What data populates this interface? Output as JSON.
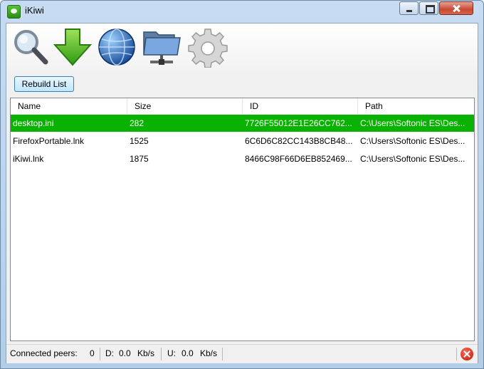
{
  "window": {
    "title": "iKiwi"
  },
  "toolbar": {
    "icons": [
      "search-icon",
      "download-icon",
      "globe-icon",
      "shared-folder-icon",
      "gear-icon"
    ]
  },
  "actions": {
    "rebuild_label": "Rebuild List"
  },
  "files": {
    "columns": [
      "Name",
      "Size",
      "ID",
      "Path"
    ],
    "rows": [
      {
        "name": "desktop.ini",
        "size": "282",
        "id": "7726F55012E1E26CC762...",
        "path": "C:\\Users\\Softonic ES\\Des...",
        "selected": true
      },
      {
        "name": "FirefoxPortable.lnk",
        "size": "1525",
        "id": "6C6D6C82CC143B8CB48...",
        "path": "C:\\Users\\Softonic ES\\Des...",
        "selected": false
      },
      {
        "name": "iKiwi.lnk",
        "size": "1875",
        "id": "8466C98F66D6EB852469...",
        "path": "C:\\Users\\Softonic ES\\Des...",
        "selected": false
      }
    ]
  },
  "status": {
    "peers_label": "Connected peers:",
    "peers_value": "0",
    "download_label": "D:",
    "download_value": "0.0",
    "download_unit": "Kb/s",
    "upload_label": "U:",
    "upload_value": "0.0",
    "upload_unit": "Kb/s"
  },
  "colors": {
    "selection": "#0ab200",
    "window_frame": "#b3cde8"
  }
}
